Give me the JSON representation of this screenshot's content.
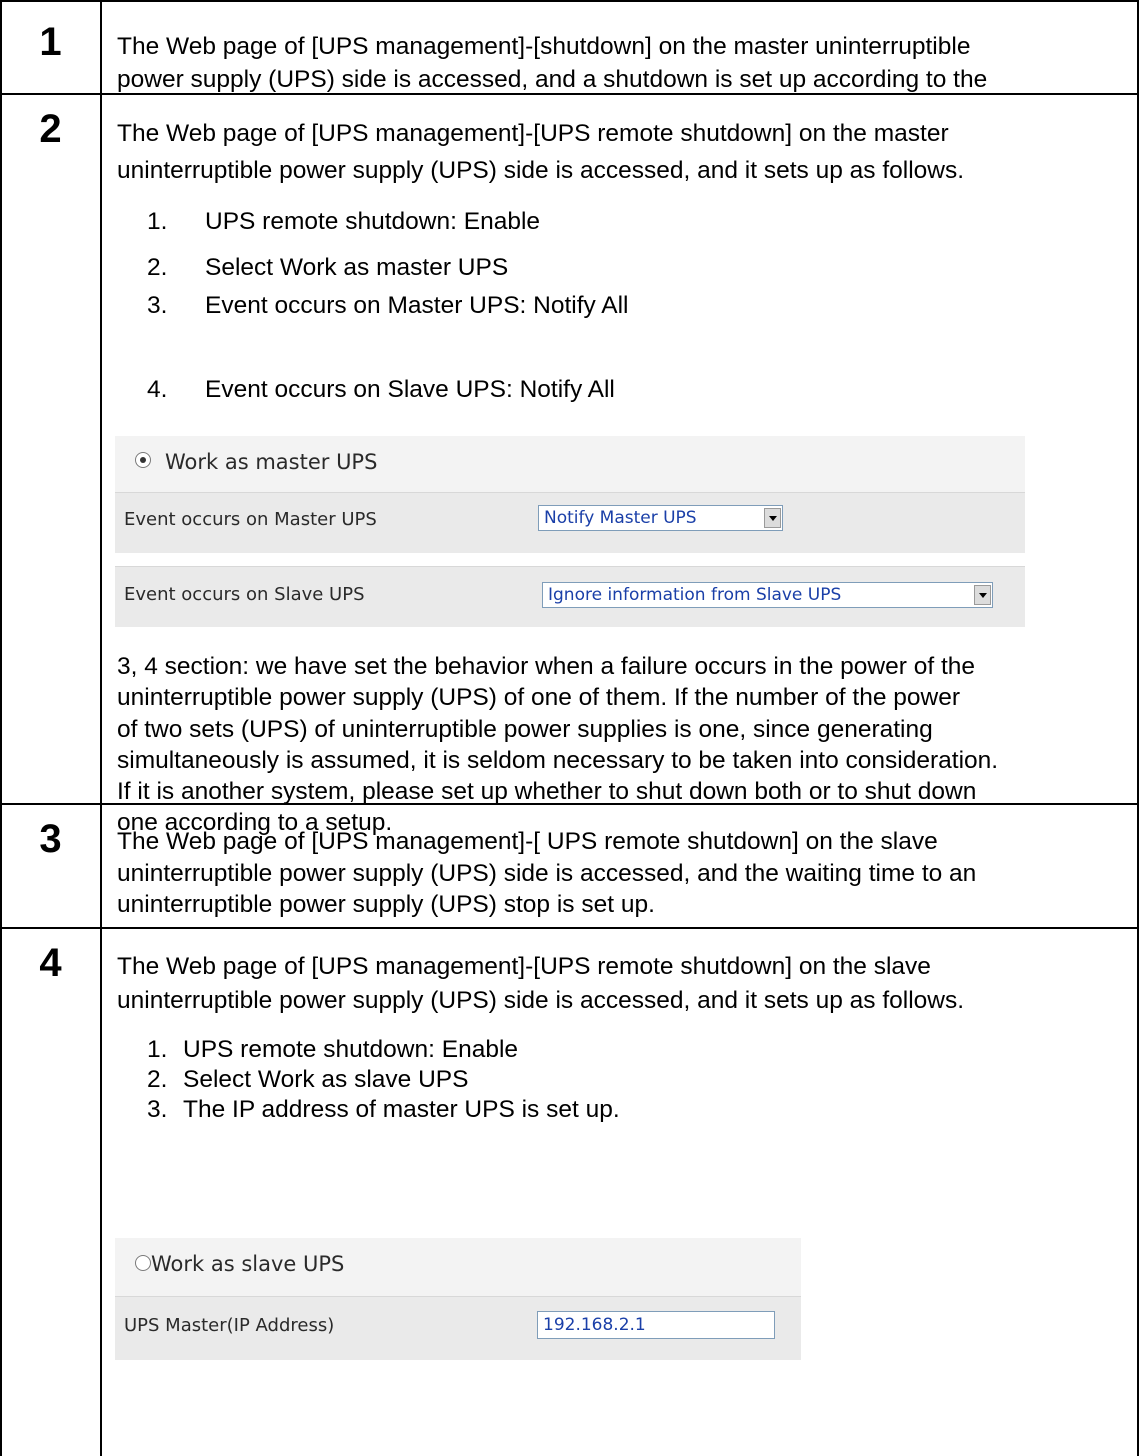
{
  "steps": [
    {
      "number": "1",
      "lines": [
        "The Web page of [UPS management]-[shutdown] on the master uninterruptible",
        "power supply (UPS) side is accessed, and a shutdown is set up according to the"
      ]
    },
    {
      "number": "2",
      "lines": [
        "The Web page of [UPS management]-[UPS remote shutdown] on the master",
        "uninterruptible power supply (UPS) side is accessed, and it sets up as follows."
      ],
      "list": [
        {
          "n": "1.",
          "text": "UPS remote shutdown: Enable"
        },
        {
          "n": "2.",
          "text": "Select  Work as master UPS"
        },
        {
          "n": "3.",
          "text": "Event occurs on Master UPS: Notify All"
        },
        {
          "n": "4.",
          "text": "Event occurs on Slave UPS: Notify All"
        }
      ],
      "screenshot": {
        "radio_label": "Work as master UPS",
        "rows": [
          {
            "label": "Event occurs on Master UPS",
            "value": "Notify Master UPS"
          },
          {
            "label": "Event occurs on Slave UPS",
            "value": "Ignore information from Slave UPS"
          }
        ]
      },
      "note": [
        "3, 4 section: we have set the behavior when a failure occurs in the power of the",
        "uninterruptible power supply (UPS) of one of them. If the number of the power",
        "of two sets (UPS) of uninterruptible power supplies is one, since generating",
        "simultaneously is assumed, it is seldom necessary to be taken into consideration.",
        "If it is another system, please set up  whether to shut down both or to shut down",
        "one according to a setup."
      ]
    },
    {
      "number": "3",
      "lines": [
        "The Web page of [UPS management]-[ UPS remote shutdown] on the slave",
        "uninterruptible power supply (UPS) side is accessed, and the waiting time to an",
        "uninterruptible power supply (UPS) stop is set up."
      ]
    },
    {
      "number": "4",
      "lines": [
        "The Web page of [UPS management]-[UPS remote shutdown] on the slave",
        "uninterruptible power supply (UPS) side is accessed, and it sets up as follows."
      ],
      "list": [
        {
          "n": "1.",
          "text": "UPS remote shutdown: Enable"
        },
        {
          "n": "2.",
          "text": "Select Work as slave UPS"
        },
        {
          "n": "3.",
          "text": "The IP address of master UPS is set up."
        }
      ],
      "screenshot": {
        "radio_label": "Work as slave UPS",
        "field_label": "UPS Master(IP Address)",
        "field_value": "192.168.2.1"
      }
    }
  ]
}
